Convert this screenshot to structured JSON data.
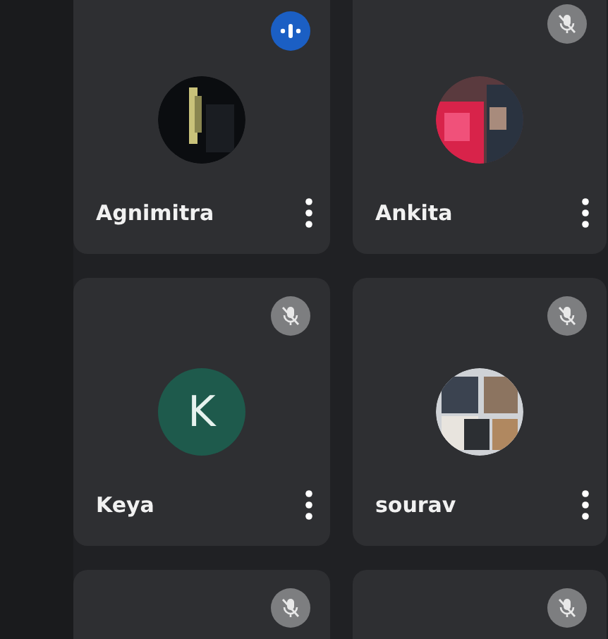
{
  "tiles": [
    {
      "name": "Agnimitra",
      "muted": false
    },
    {
      "name": "Ankita",
      "muted": true
    },
    {
      "name": "Keya",
      "muted": true,
      "avatar": {
        "kind": "initial",
        "letter": "K",
        "color": "#1e5a4c"
      }
    },
    {
      "name": "sourav",
      "muted": true
    },
    {
      "muted": true
    },
    {
      "muted": true
    }
  ]
}
